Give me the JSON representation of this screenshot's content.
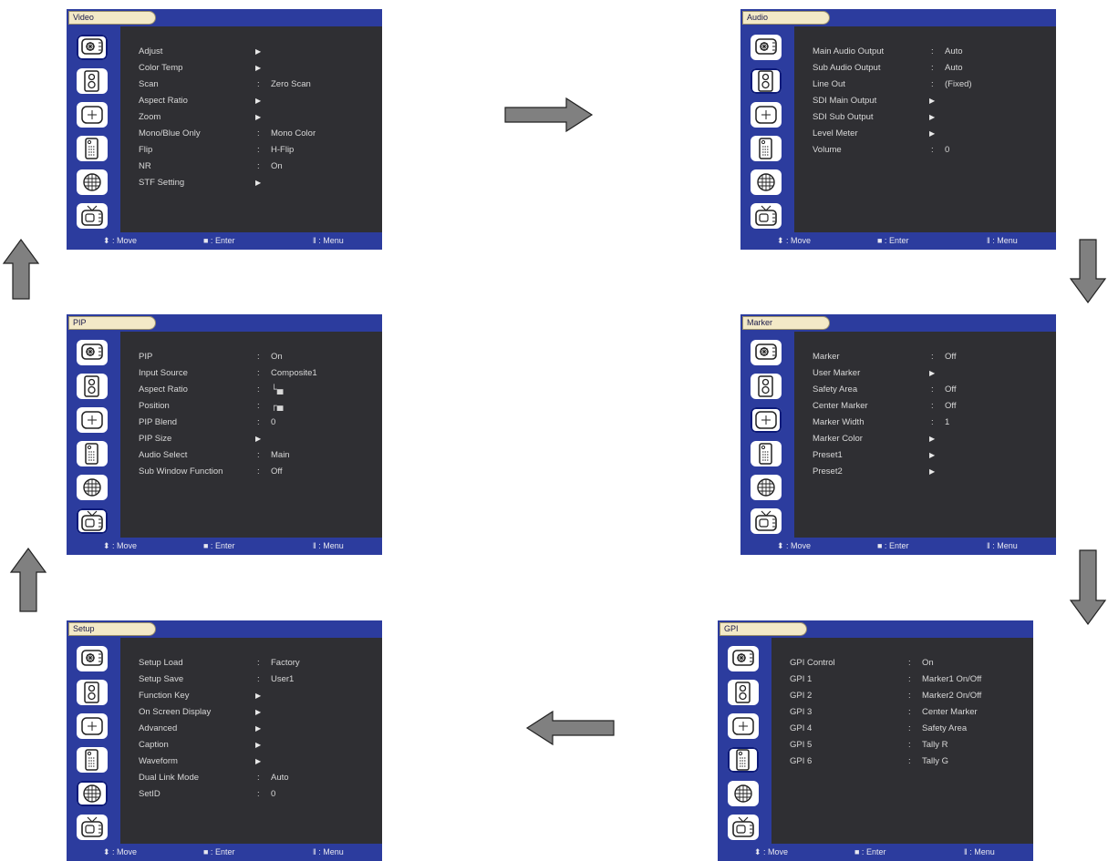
{
  "footer": {
    "move": "⬍ : Move",
    "enter": "■ : Enter",
    "menu": "‖ : Menu"
  },
  "screens": [
    {
      "id": "video",
      "title": "Video",
      "selected_icon": 0,
      "rows": [
        {
          "label": "Adjust",
          "submenu": true,
          "value": ""
        },
        {
          "label": "Color Temp",
          "submenu": true,
          "value": ""
        },
        {
          "label": "Scan",
          "submenu": false,
          "value": "Zero Scan"
        },
        {
          "label": "Aspect Ratio",
          "submenu": true,
          "value": ""
        },
        {
          "label": "Zoom",
          "submenu": true,
          "value": ""
        },
        {
          "label": "Mono/Blue Only",
          "submenu": false,
          "value": "Mono Color"
        },
        {
          "label": "Flip",
          "submenu": false,
          "value": "H-Flip"
        },
        {
          "label": "NR",
          "submenu": false,
          "value": "On"
        },
        {
          "label": "STF Setting",
          "submenu": true,
          "value": ""
        }
      ]
    },
    {
      "id": "audio",
      "title": "Audio",
      "selected_icon": 1,
      "rows": [
        {
          "label": "Main Audio Output",
          "submenu": false,
          "value": "Auto"
        },
        {
          "label": "Sub Audio Output",
          "submenu": false,
          "value": "Auto"
        },
        {
          "label": "Line Out",
          "submenu": false,
          "value": "(Fixed)"
        },
        {
          "label": "SDI Main Output",
          "submenu": true,
          "value": ""
        },
        {
          "label": "SDI Sub Output",
          "submenu": true,
          "value": ""
        },
        {
          "label": "Level Meter",
          "submenu": true,
          "value": ""
        },
        {
          "label": "Volume",
          "submenu": false,
          "value": "0"
        }
      ]
    },
    {
      "id": "pip",
      "title": "PIP",
      "selected_icon": 5,
      "rows": [
        {
          "label": "PIP",
          "submenu": false,
          "value": "On"
        },
        {
          "label": "Input Source",
          "submenu": false,
          "value": "Composite1"
        },
        {
          "label": "Aspect Ratio",
          "submenu": false,
          "value": "└▄"
        },
        {
          "label": "Position",
          "submenu": false,
          "value": "┌▄"
        },
        {
          "label": "PIP Blend",
          "submenu": false,
          "value": "0"
        },
        {
          "label": "PIP Size",
          "submenu": true,
          "value": ""
        },
        {
          "label": "Audio Select",
          "submenu": false,
          "value": "Main"
        },
        {
          "label": "Sub Window Function",
          "submenu": false,
          "value": "Off"
        }
      ]
    },
    {
      "id": "marker",
      "title": "Marker",
      "selected_icon": 2,
      "rows": [
        {
          "label": "Marker",
          "submenu": false,
          "value": "Off"
        },
        {
          "label": "User Marker",
          "submenu": true,
          "value": ""
        },
        {
          "label": "Safety Area",
          "submenu": false,
          "value": "Off"
        },
        {
          "label": "Center Marker",
          "submenu": false,
          "value": "Off"
        },
        {
          "label": "Marker Width",
          "submenu": false,
          "value": "1"
        },
        {
          "label": "Marker Color",
          "submenu": true,
          "value": ""
        },
        {
          "label": "Preset1",
          "submenu": true,
          "value": ""
        },
        {
          "label": "Preset2",
          "submenu": true,
          "value": ""
        }
      ]
    },
    {
      "id": "setup",
      "title": "Setup",
      "selected_icon": 4,
      "rows": [
        {
          "label": "Setup Load",
          "submenu": false,
          "value": "Factory"
        },
        {
          "label": "Setup Save",
          "submenu": false,
          "value": "User1"
        },
        {
          "label": "Function Key",
          "submenu": true,
          "value": ""
        },
        {
          "label": "On Screen Display",
          "submenu": true,
          "value": ""
        },
        {
          "label": "Advanced",
          "submenu": true,
          "value": ""
        },
        {
          "label": "Caption",
          "submenu": true,
          "value": ""
        },
        {
          "label": "Waveform",
          "submenu": true,
          "value": ""
        },
        {
          "label": "Dual Link Mode",
          "submenu": false,
          "value": "Auto"
        },
        {
          "label": "SetID",
          "submenu": false,
          "value": "0"
        }
      ]
    },
    {
      "id": "gpi",
      "title": "GPI",
      "selected_icon": 3,
      "rows": [
        {
          "label": "GPI Control",
          "submenu": false,
          "value": "On"
        },
        {
          "label": "GPI 1",
          "submenu": false,
          "value": "Marker1 On/Off"
        },
        {
          "label": "GPI 2",
          "submenu": false,
          "value": "Marker2 On/Off"
        },
        {
          "label": "GPI 3",
          "submenu": false,
          "value": "Center Marker"
        },
        {
          "label": "GPI 4",
          "submenu": false,
          "value": "Safety Area"
        },
        {
          "label": "GPI 5",
          "submenu": false,
          "value": "Tally R"
        },
        {
          "label": "GPI 6",
          "submenu": false,
          "value": "Tally G"
        }
      ]
    }
  ],
  "icons": [
    "video-icon",
    "audio-icon",
    "marker-icon",
    "gpi-icon",
    "setup-icon",
    "pip-icon"
  ],
  "colors": {
    "sidebar": "#2c3c9e",
    "panel": "#2f2f33",
    "tab": "#f3e9c7",
    "arrow": "#808080"
  }
}
